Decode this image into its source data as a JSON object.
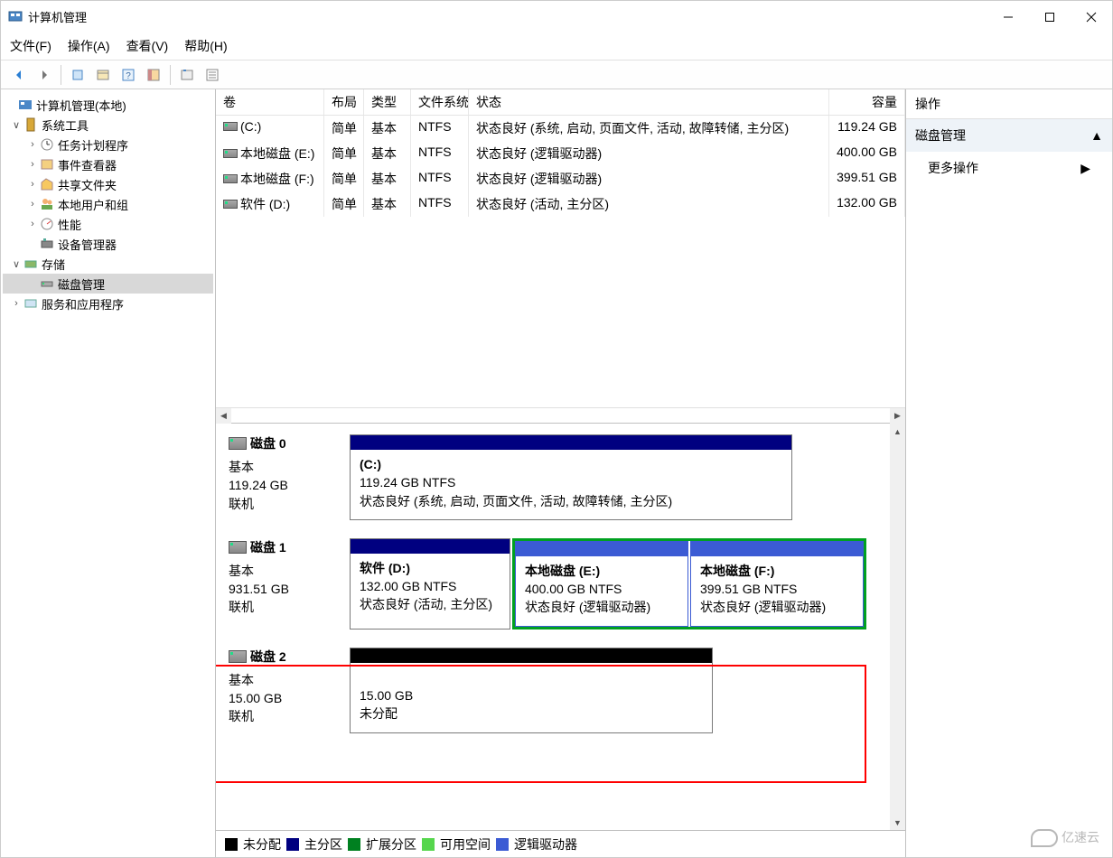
{
  "window": {
    "title": "计算机管理"
  },
  "menu": {
    "file": "文件(F)",
    "action": "操作(A)",
    "view": "查看(V)",
    "help": "帮助(H)"
  },
  "tree": {
    "root": "计算机管理(本地)",
    "systools": "系统工具",
    "tasksch": "任务计划程序",
    "eventv": "事件查看器",
    "shared": "共享文件夹",
    "users": "本地用户和组",
    "perf": "性能",
    "devmgr": "设备管理器",
    "storage": "存储",
    "diskmgmt": "磁盘管理",
    "services": "服务和应用程序"
  },
  "cols": {
    "vol": "卷",
    "layout": "布局",
    "type": "类型",
    "fs": "文件系统",
    "status": "状态",
    "cap": "容量"
  },
  "vols": [
    {
      "name": "(C:)",
      "layout": "简单",
      "type": "基本",
      "fs": "NTFS",
      "status": "状态良好 (系统, 启动, 页面文件, 活动, 故障转储, 主分区)",
      "cap": "119.24 GB"
    },
    {
      "name": "本地磁盘 (E:)",
      "layout": "简单",
      "type": "基本",
      "fs": "NTFS",
      "status": "状态良好 (逻辑驱动器)",
      "cap": "400.00 GB"
    },
    {
      "name": "本地磁盘 (F:)",
      "layout": "简单",
      "type": "基本",
      "fs": "NTFS",
      "status": "状态良好 (逻辑驱动器)",
      "cap": "399.51 GB"
    },
    {
      "name": "软件 (D:)",
      "layout": "简单",
      "type": "基本",
      "fs": "NTFS",
      "status": "状态良好 (活动, 主分区)",
      "cap": "132.00 GB"
    }
  ],
  "disk0": {
    "title": "磁盘 0",
    "type": "基本",
    "size": "119.24 GB",
    "online": "联机",
    "p1name": "(C:)",
    "p1size": "119.24 GB NTFS",
    "p1stat": "状态良好 (系统, 启动, 页面文件, 活动, 故障转储, 主分区)"
  },
  "disk1": {
    "title": "磁盘 1",
    "type": "基本",
    "size": "931.51 GB",
    "online": "联机",
    "p1name": "软件 (D:)",
    "p1size": "132.00 GB NTFS",
    "p1stat": "状态良好 (活动, 主分区)",
    "p2name": "本地磁盘 (E:)",
    "p2size": "400.00 GB NTFS",
    "p2stat": "状态良好 (逻辑驱动器)",
    "p3name": "本地磁盘 (F:)",
    "p3size": "399.51 GB NTFS",
    "p3stat": "状态良好 (逻辑驱动器)"
  },
  "disk2": {
    "title": "磁盘 2",
    "type": "基本",
    "size": "15.00 GB",
    "online": "联机",
    "p1size": "15.00 GB",
    "p1stat": "未分配"
  },
  "legend": {
    "unalloc": "未分配",
    "primary": "主分区",
    "extended": "扩展分区",
    "free": "可用空间",
    "logical": "逻辑驱动器"
  },
  "actions": {
    "title": "操作",
    "diskmgmt": "磁盘管理",
    "more": "更多操作"
  },
  "watermark": "亿速云"
}
